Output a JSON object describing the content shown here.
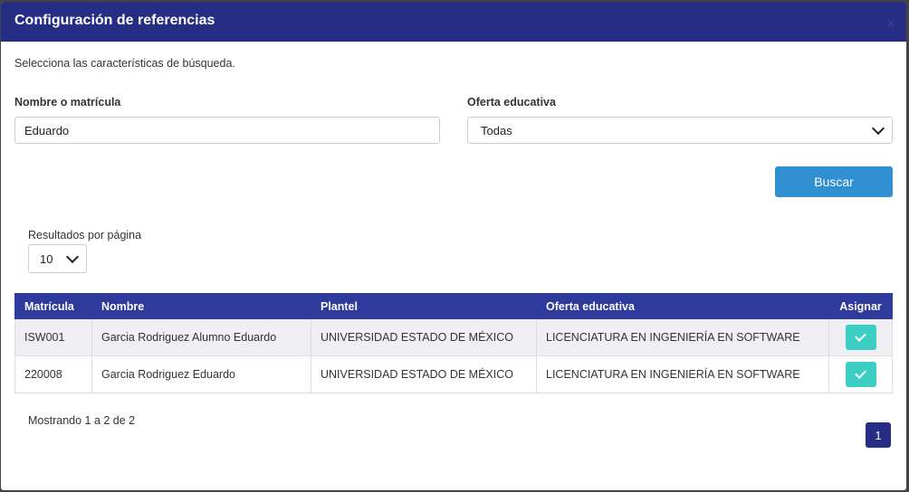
{
  "modal": {
    "title": "Configuración de referencias",
    "close_label": "x",
    "subtitle": "Selecciona las características de búsqueda."
  },
  "form": {
    "name_label": "Nombre o matrícula",
    "name_value": "Eduardo",
    "offer_label": "Oferta educativa",
    "offer_value": "Todas",
    "search_label": "Buscar"
  },
  "results": {
    "per_page_label": "Resultados por página",
    "per_page_value": "10",
    "columns": [
      "Matrícula",
      "Nombre",
      "Plantel",
      "Oferta educativa",
      "Asignar"
    ],
    "rows": [
      {
        "matricula": "ISW001",
        "nombre": "Garcia Rodriguez Alumno Eduardo",
        "plantel": "UNIVERSIDAD ESTADO DE MÉXICO",
        "oferta": "LICENCIATURA EN INGENIERÍA EN SOFTWARE"
      },
      {
        "matricula": "220008",
        "nombre": "Garcia Rodriguez Eduardo",
        "plantel": "UNIVERSIDAD ESTADO DE MÉXICO",
        "oferta": "LICENCIATURA EN INGENIERÍA EN SOFTWARE"
      }
    ],
    "showing_text": "Mostrando 1 a 2 de 2",
    "current_page": "1"
  },
  "colors": {
    "header": "#252d85",
    "table_header": "#2f3a9d",
    "search_button": "#2f8fd0",
    "assign_button": "#3ccdc3"
  }
}
